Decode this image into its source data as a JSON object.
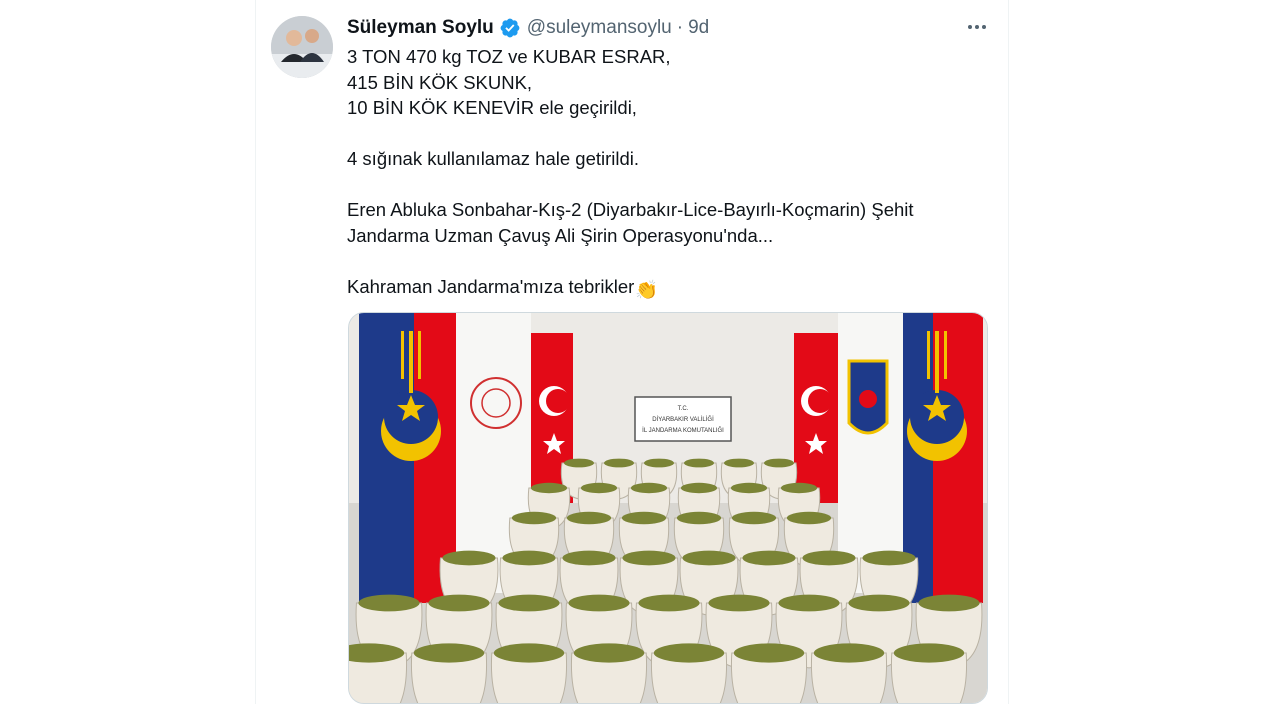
{
  "tweet": {
    "author_name": "Süleyman Soylu",
    "handle": "@suleymansoylu",
    "separator": "·",
    "time": "9d",
    "verified_icon": "verified-badge-icon",
    "more_icon": "more-options-icon",
    "lines": [
      "3 TON 470 kg TOZ ve KUBAR ESRAR,",
      "415 BİN KÖK SKUNK,",
      "10 BİN KÖK KENEVİR ele geçirildi,",
      "",
      "4 sığınak kullanılamaz hale getirildi.",
      "",
      "Eren Abluka Sonbahar-Kış-2 (Diyarbakır-Lice-Bayırlı-Koçmarin) Şehit",
      "Jandarma Uzman Çavuş Ali Şirin Operasyonu'nda...",
      "",
      "Kahraman Jandarma'mıza tebrikler"
    ],
    "emoji": "👏"
  },
  "media": {
    "sign_lines": [
      "T.C.",
      "DİYARBAKIR VALİLİĞİ",
      "İL JANDARMA KOMUTANLIĞI"
    ]
  },
  "colors": {
    "verified": "#1d9bf0",
    "text": "#0f1419",
    "secondary": "#536471",
    "flag_red": "#e30a17",
    "banner_blue": "#1e3a8a",
    "crescent_gold": "#f2c200"
  }
}
